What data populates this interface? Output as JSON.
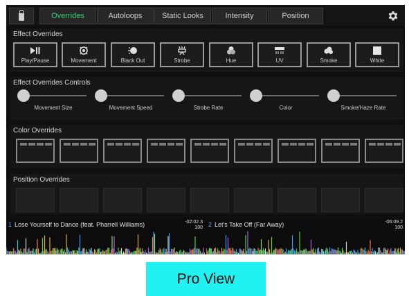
{
  "topbar": {
    "tabs": [
      {
        "label": "Overrides",
        "active": true
      },
      {
        "label": "Autoloops",
        "active": false
      },
      {
        "label": "Static Looks",
        "active": false
      },
      {
        "label": "Intensity",
        "active": false
      },
      {
        "label": "Position",
        "active": false
      }
    ],
    "usb_icon": "usb-drive-icon",
    "settings_icon": "gear-icon",
    "active_color": "#35d27a"
  },
  "effect_overrides": {
    "title": "Effect Overrides",
    "buttons": [
      {
        "label": "Play/Pause",
        "icon": "play-pause-icon"
      },
      {
        "label": "Movement",
        "icon": "movement-icon"
      },
      {
        "label": "Black Out",
        "icon": "blackout-icon"
      },
      {
        "label": "Strobe",
        "icon": "strobe-icon"
      },
      {
        "label": "Hue",
        "icon": "hue-icon"
      },
      {
        "label": "UV",
        "icon": "uv-icon"
      },
      {
        "label": "Smoke",
        "icon": "smoke-icon"
      },
      {
        "label": "White",
        "icon": "white-square-icon"
      }
    ]
  },
  "effect_controls": {
    "title": "Effect Overrides Controls",
    "sliders": [
      {
        "label": "Movement Size",
        "value": 0
      },
      {
        "label": "Movement Speed",
        "value": 0
      },
      {
        "label": "Strobe Rate",
        "value": 0
      },
      {
        "label": "Color",
        "value": 0
      },
      {
        "label": "Smoke/Haze Rate",
        "value": 0
      }
    ]
  },
  "color_overrides": {
    "title": "Color Overrides",
    "slots": 9
  },
  "position_overrides": {
    "title": "Position Overrides",
    "slots": 9
  },
  "decks": [
    {
      "number": "1",
      "title": "Lose Yourself to Dance (feat. Pharrell Williams)",
      "time": "-02:02.3",
      "bpm": "100"
    },
    {
      "number": "2",
      "title": "Let's Take Off (Far Away)",
      "time": "-06:09.2",
      "bpm": "100"
    }
  ],
  "pro_view": {
    "label": "Pro View",
    "color": "#20f2f2"
  }
}
